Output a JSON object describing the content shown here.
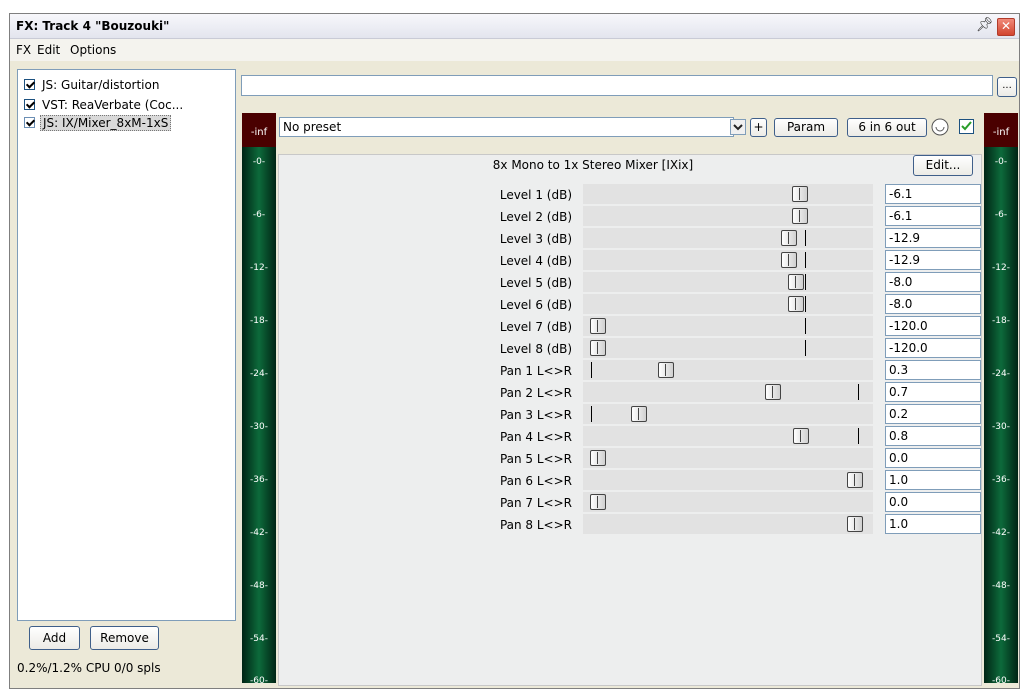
{
  "window": {
    "title": "FX: Track 4 \"Bouzouki\"",
    "pin_icon": "pin-icon",
    "close_icon": "close-icon"
  },
  "menu": [
    "FX",
    "Edit",
    "Options"
  ],
  "fx_chain": [
    {
      "name": "JS: Guitar/distortion",
      "enabled": true,
      "selected": false
    },
    {
      "name": "VST: ReaVerbate (Coc...",
      "enabled": true,
      "selected": false
    },
    {
      "name": "JS: IX/Mixer_8xM-1xS",
      "enabled": true,
      "selected": true
    }
  ],
  "buttons": {
    "add": "Add",
    "remove": "Remove",
    "browse": "...",
    "plus": "+",
    "param": "Param",
    "io": "6 in 6 out",
    "edit": "Edit..."
  },
  "cpu_status": "0.2%/1.2% CPU 0/0 spls",
  "preset": "No preset",
  "plugin_name": "8x Mono to 1x Stereo Mixer [IXix]",
  "meter_labels": {
    "top": "-inf",
    "ticks": [
      "-0-",
      "-6-",
      "-12-",
      "-18-",
      "-24-",
      "-30-",
      "-36-",
      "-42-",
      "-48-",
      "-54-",
      "-60-"
    ]
  },
  "params": [
    {
      "label": "Level 1 (dB)",
      "value": "-6.1"
    },
    {
      "label": "Level 2 (dB)",
      "value": "-6.1"
    },
    {
      "label": "Level 3 (dB)",
      "value": "-12.9"
    },
    {
      "label": "Level 4 (dB)",
      "value": "-12.9"
    },
    {
      "label": "Level 5 (dB)",
      "value": "-8.0"
    },
    {
      "label": "Level 6 (dB)",
      "value": "-8.0"
    },
    {
      "label": "Level 7 (dB)",
      "value": "-120.0"
    },
    {
      "label": "Level 8 (dB)",
      "value": "-120.0"
    },
    {
      "label": "Pan 1 L<>R",
      "value": "0.3"
    },
    {
      "label": "Pan 2 L<>R",
      "value": "0.7"
    },
    {
      "label": "Pan 3 L<>R",
      "value": "0.2"
    },
    {
      "label": "Pan 4 L<>R",
      "value": "0.8"
    },
    {
      "label": "Pan 5 L<>R",
      "value": "0.0"
    },
    {
      "label": "Pan 6 L<>R",
      "value": "1.0"
    },
    {
      "label": "Pan 7 L<>R",
      "value": "0.0"
    },
    {
      "label": "Pan 8 L<>R",
      "value": "1.0"
    }
  ]
}
